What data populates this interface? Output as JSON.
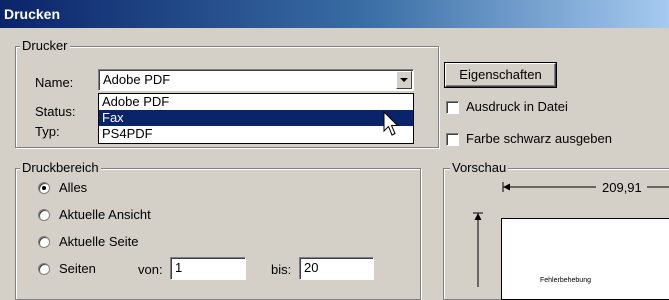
{
  "window": {
    "title": "Drucken"
  },
  "printer": {
    "legend": "Drucker",
    "name_label": "Name:",
    "name_value": "Adobe PDF",
    "status_label": "Status:",
    "type_label": "Typ:",
    "dropdown_options": [
      "Adobe PDF",
      "Fax",
      "PS4PDF"
    ],
    "highlighted_option": "Fax",
    "properties_button": "Eigenschaften",
    "print_to_file": "Ausdruck in Datei",
    "print_to_file_checked": false,
    "grayscale": "Farbe schwarz ausgeben",
    "grayscale_checked": false
  },
  "range": {
    "legend": "Druckbereich",
    "options": [
      "Alles",
      "Aktuelle Ansicht",
      "Aktuelle Seite",
      "Seiten"
    ],
    "selected": "Alles",
    "from_label": "von:",
    "from_value": "1",
    "to_label": "bis:",
    "to_value": "20"
  },
  "preview": {
    "legend": "Vorschau",
    "width_value": "209,91",
    "page_text": "Fehlerbehebung"
  },
  "colors": {
    "title_gradient_start": "#0a246a",
    "title_gradient_end": "#a6caf0",
    "dialog_bg": "#d4d0c8",
    "selection": "#0a246a"
  }
}
